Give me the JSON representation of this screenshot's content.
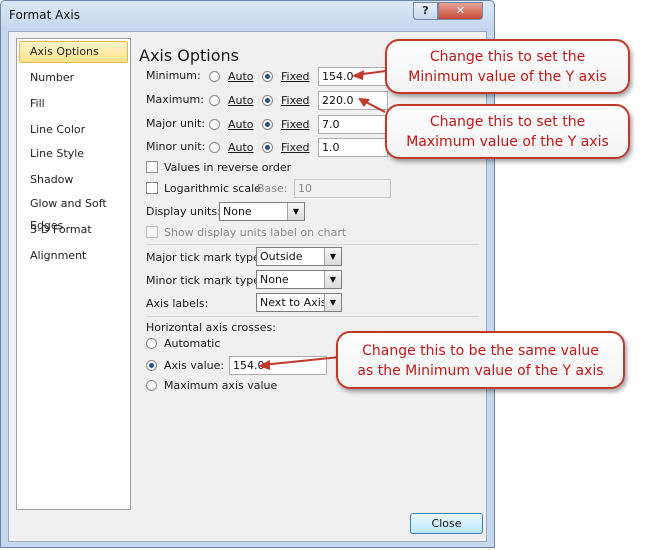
{
  "window": {
    "title": "Format Axis",
    "help_label": "?",
    "close_label": "✕"
  },
  "nav": {
    "items": [
      {
        "label": "Axis Options",
        "selected": true
      },
      {
        "label": "Number"
      },
      {
        "label": "Fill"
      },
      {
        "label": "Line Color"
      },
      {
        "label": "Line Style"
      },
      {
        "label": "Shadow"
      },
      {
        "label": "Glow and Soft Edges"
      },
      {
        "label": "3-D Format"
      },
      {
        "label": "Alignment"
      }
    ]
  },
  "panel": {
    "title": "Axis Options",
    "auto_label": "Auto",
    "fixed_label": "Fixed",
    "rows": [
      {
        "label": "Minimum:",
        "mode": "Fixed",
        "value": "154.0"
      },
      {
        "label": "Maximum:",
        "mode": "Fixed",
        "value": "220.0"
      },
      {
        "label": "Major unit:",
        "mode": "Fixed",
        "value": "7.0"
      },
      {
        "label": "Minor unit:",
        "mode": "Fixed",
        "value": "1.0"
      }
    ],
    "values_reverse_label": "Values in reverse order",
    "log_scale_label": "Logarithmic scale",
    "base_label": "Base:",
    "base_value": "10",
    "display_units_label": "Display units:",
    "display_units_value": "None",
    "show_units_label": "Show display units label on chart",
    "major_tick_label": "Major tick mark type:",
    "major_tick_value": "Outside",
    "minor_tick_label": "Minor tick mark type:",
    "minor_tick_value": "None",
    "axis_labels_label": "Axis labels:",
    "axis_labels_value": "Next to Axis",
    "h_axis_crosses_label": "Horizontal axis crosses:",
    "automatic_label": "Automatic",
    "axis_value_label": "Axis value:",
    "axis_value": "154.0",
    "max_axis_value_label": "Maximum axis value",
    "selected_crossing": "Axis value"
  },
  "footer": {
    "close_button": "Close"
  },
  "callouts": [
    {
      "line1": "Change this to set the",
      "line2": "Minimum value of the Y axis"
    },
    {
      "line1": "Change this to set the",
      "line2": "Maximum value of the Y axis"
    },
    {
      "line1": "Change this to be the same value",
      "line2": "as the Minimum value of the Y axis"
    }
  ],
  "colors": {
    "callout_border": "#c0392b",
    "callout_text": "#c01818",
    "selection": "#ffe48a"
  }
}
